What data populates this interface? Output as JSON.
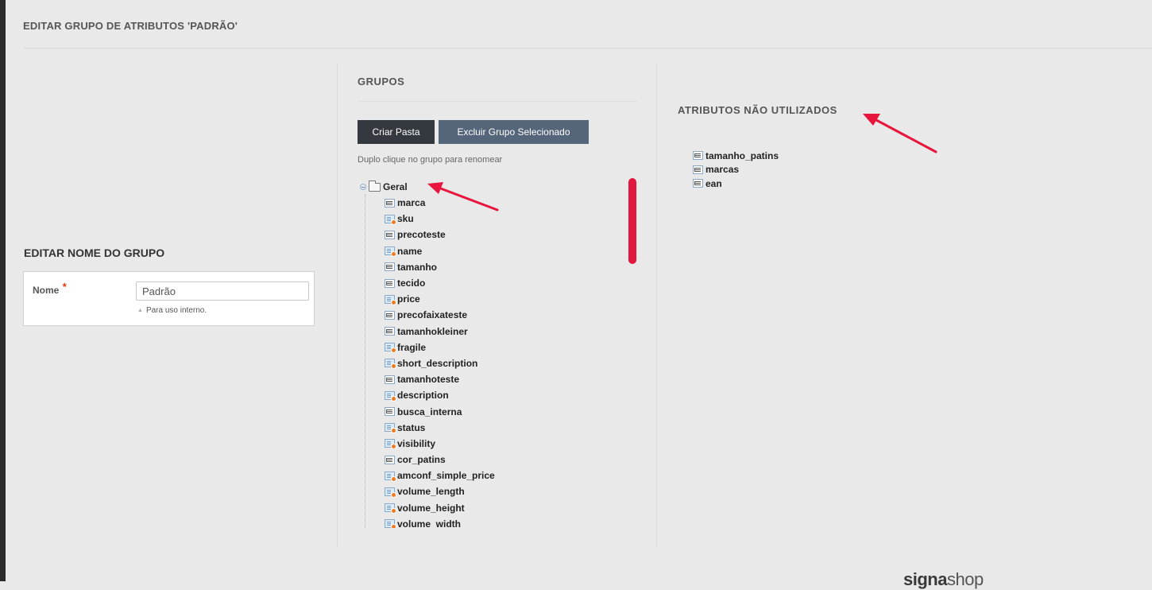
{
  "page": {
    "title": "EDITAR GRUPO DE ATRIBUTOS 'PADRÃO'"
  },
  "edit_name": {
    "section_title": "EDITAR NOME DO GRUPO",
    "field_label": "Nome",
    "required_marker": "*",
    "value": "Padrão",
    "hint": "Para uso interno."
  },
  "groups": {
    "section_title": "GRUPOS",
    "create_button": "Criar Pasta",
    "delete_button": "Excluir Grupo Selecionado",
    "help_text": "Duplo clique no grupo para renomear",
    "root": {
      "label": "Geral",
      "icon": "folder-icon",
      "expanded": true
    },
    "items": [
      {
        "label": "marca",
        "icon": "text-attribute-icon"
      },
      {
        "label": "sku",
        "icon": "system-attribute-icon"
      },
      {
        "label": "precoteste",
        "icon": "text-attribute-icon"
      },
      {
        "label": "name",
        "icon": "system-attribute-icon"
      },
      {
        "label": "tamanho",
        "icon": "text-attribute-icon"
      },
      {
        "label": "tecido",
        "icon": "text-attribute-icon"
      },
      {
        "label": "price",
        "icon": "system-attribute-icon"
      },
      {
        "label": "precofaixateste",
        "icon": "text-attribute-icon"
      },
      {
        "label": "tamanhokleiner",
        "icon": "text-attribute-icon"
      },
      {
        "label": "fragile",
        "icon": "system-attribute-icon"
      },
      {
        "label": "short_description",
        "icon": "system-attribute-icon"
      },
      {
        "label": "tamanhoteste",
        "icon": "text-attribute-icon"
      },
      {
        "label": "description",
        "icon": "system-attribute-icon"
      },
      {
        "label": "busca_interna",
        "icon": "text-attribute-icon"
      },
      {
        "label": "status",
        "icon": "system-attribute-icon"
      },
      {
        "label": "visibility",
        "icon": "system-attribute-icon"
      },
      {
        "label": "cor_patins",
        "icon": "text-attribute-icon"
      },
      {
        "label": "amconf_simple_price",
        "icon": "system-attribute-icon"
      },
      {
        "label": "volume_length",
        "icon": "system-attribute-icon"
      },
      {
        "label": "volume_height",
        "icon": "system-attribute-icon"
      },
      {
        "label": "volume_width",
        "icon": "system-attribute-icon"
      }
    ]
  },
  "unused": {
    "section_title": "ATRIBUTOS NÃO UTILIZADOS",
    "items": [
      {
        "label": "tamanho_patins",
        "icon": "text-attribute-icon"
      },
      {
        "label": "marcas",
        "icon": "text-attribute-icon"
      },
      {
        "label": "ean",
        "icon": "text-attribute-icon"
      }
    ]
  },
  "footer": {
    "logo_bold": "signa",
    "logo_thin": "shop"
  },
  "colors": {
    "annotation_arrow": "#e8153d",
    "scrollbar_thumb": "#e3163f",
    "primary_button": "#33393f",
    "secondary_button": "#55657a",
    "required": "#eb340a"
  }
}
